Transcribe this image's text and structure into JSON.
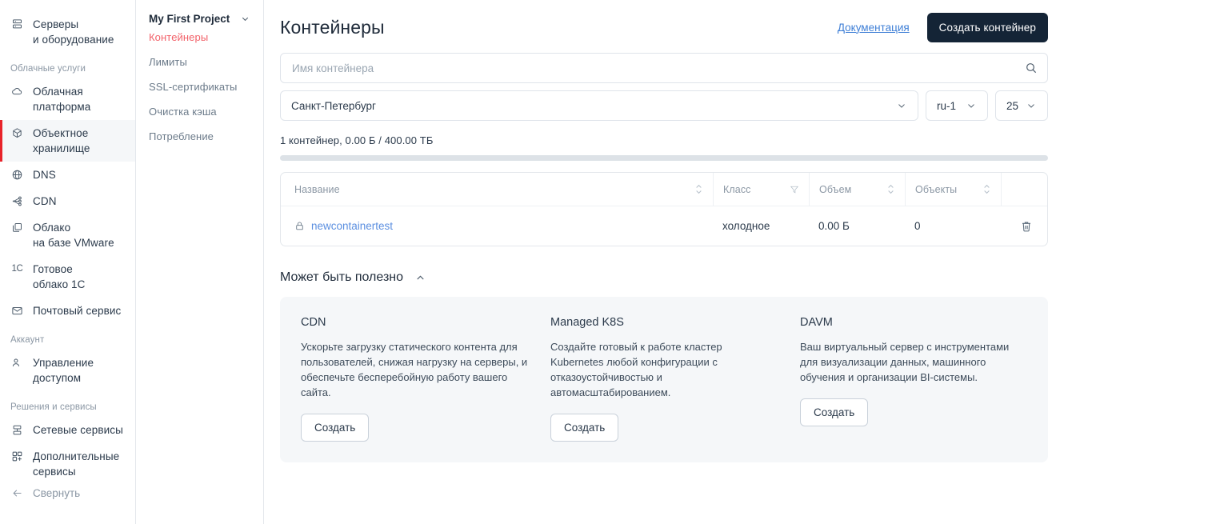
{
  "sidebar": {
    "top_items": [
      {
        "icon": "servers-icon",
        "label": "Серверы\nи оборудование",
        "line1": "Серверы",
        "line2": "и оборудование"
      }
    ],
    "sections": [
      {
        "label": "Облачные услуги",
        "items": [
          {
            "icon": "cloud-icon",
            "line1": "Облачная",
            "line2": "платформа",
            "active": false
          },
          {
            "icon": "cube-icon",
            "line1": "Объектное",
            "line2": "хранилище",
            "active": true
          },
          {
            "icon": "globe-icon",
            "line1": "DNS",
            "line2": "",
            "active": false
          },
          {
            "icon": "cdn-icon",
            "line1": "CDN",
            "line2": "",
            "active": false
          },
          {
            "icon": "vmware-icon",
            "line1": "Облако",
            "line2": "на базе VMware",
            "active": false
          },
          {
            "icon": "one-c-icon",
            "line1": "Готовое",
            "line2": "облако 1С",
            "active": false
          },
          {
            "icon": "mail-icon",
            "line1": "Почтовый сервис",
            "line2": "",
            "active": false
          }
        ]
      },
      {
        "label": "Аккаунт",
        "items": [
          {
            "icon": "users-icon",
            "line1": "Управление",
            "line2": "доступом",
            "active": false
          }
        ]
      },
      {
        "label": "Решения и сервисы",
        "items": [
          {
            "icon": "network-icon",
            "line1": "Сетевые сервисы",
            "line2": "",
            "active": false
          },
          {
            "icon": "grid-plus-icon",
            "line1": "Дополнительные",
            "line2": "сервисы",
            "active": false
          }
        ]
      }
    ],
    "collapse": {
      "icon": "arrow-left-icon",
      "label": "Свернуть"
    },
    "one_c_glyph": "1C"
  },
  "project_panel": {
    "name": "My First Project",
    "chevron": "chevron-down-icon",
    "links": [
      {
        "label": "Контейнеры",
        "active": true
      },
      {
        "label": "Лимиты",
        "active": false
      },
      {
        "label": "SSL-сертификаты",
        "active": false
      },
      {
        "label": "Очистка кэша",
        "active": false
      },
      {
        "label": "Потребление",
        "active": false
      }
    ]
  },
  "header": {
    "title": "Контейнеры",
    "doc_link": "Документация",
    "create_button": "Создать контейнер"
  },
  "search": {
    "placeholder": "Имя контейнера",
    "value": ""
  },
  "filters": {
    "region": "Санкт-Петербург",
    "zone": "ru-1",
    "page_size": "25"
  },
  "summary": {
    "text": "1 контейнер, 0.00 Б / 400.00 ТБ",
    "progress_percent": 0
  },
  "table": {
    "columns": [
      {
        "label": "Название",
        "control": "sort-icon"
      },
      {
        "label": "Класс",
        "control": "filter-icon"
      },
      {
        "label": "Объем",
        "control": "sort-icon"
      },
      {
        "label": "Объекты",
        "control": "sort-icon"
      },
      {
        "label": "",
        "control": ""
      }
    ],
    "rows": [
      {
        "name": "newcontainertest",
        "lock": "lock-icon",
        "class": "холодное",
        "size": "0.00 Б",
        "objects": "0",
        "action": "delete-icon"
      }
    ]
  },
  "useful": {
    "title": "Может быть полезно",
    "chevron": "chevron-up-icon",
    "cards": [
      {
        "title": "CDN",
        "text": "Ускорьте загрузку статического контента для пользователей, снижая нагрузку на серверы, и обеспечьте бесперебойную работу вашего сайта.",
        "button": "Создать"
      },
      {
        "title": "Managed K8S",
        "text": "Создайте готовый к работе кластер Kubernetes любой конфигурации с отказоустойчивостью и автомасштабированием.",
        "button": "Создать"
      },
      {
        "title": "DAVM",
        "text": "Ваш виртуальный сервер с инструментами для визуализации данных, машинного обучения и организации BI-системы.",
        "button": "Создать"
      }
    ]
  },
  "colors": {
    "accent_red": "#e8232a",
    "link_blue": "#3f7fd6",
    "primary_dark": "#142436",
    "active_item_bg": "#f5f7f9",
    "card_bg": "#f5f7f9",
    "border": "#e3e7ec"
  }
}
